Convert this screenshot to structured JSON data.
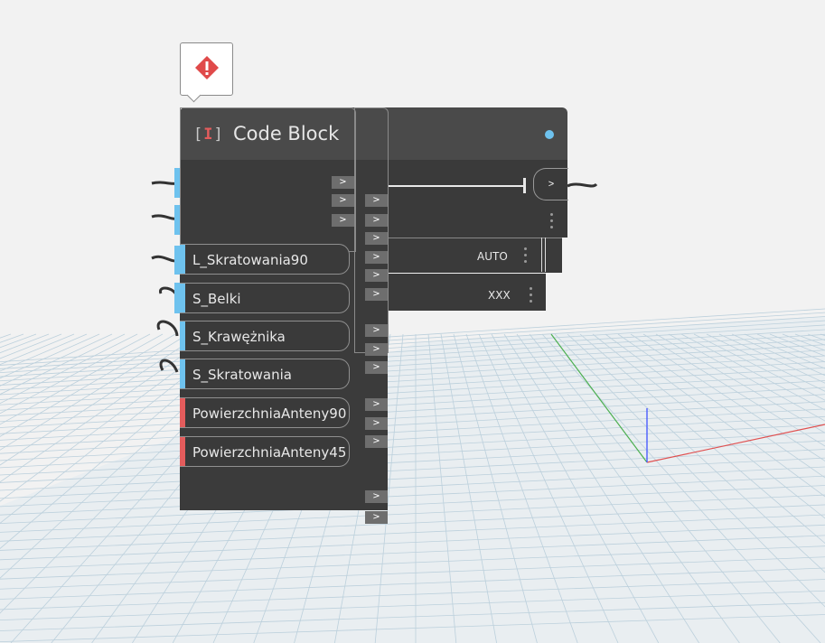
{
  "node": {
    "title": "Code Block",
    "icon": "code-block-icon"
  },
  "warning": {
    "icon": "warning-diamond-icon",
    "color": "#e04a4a"
  },
  "inputs": [
    {
      "label": "L_Skratowania90",
      "color": "#6ec2ee"
    },
    {
      "label": "S_Belki",
      "color": "#6ec2ee"
    },
    {
      "label": "S_Krawężnika",
      "color": "#6ec2ee"
    },
    {
      "label": "S_Skratowania",
      "color": "#6ec2ee"
    },
    {
      "label": "PowierzchniaAnteny90",
      "color": "#e45c5c"
    },
    {
      "label": "PowierzchniaAnteny45",
      "color": "#e45c5c"
    }
  ],
  "side_nodes": {
    "auto_label": "AUTO",
    "xxx_label": "XXX"
  },
  "port_glyph": ">",
  "colors": {
    "status_dot": "#6ec2ee",
    "accent_blue": "#6ec2ee",
    "accent_red": "#e45c5c"
  }
}
